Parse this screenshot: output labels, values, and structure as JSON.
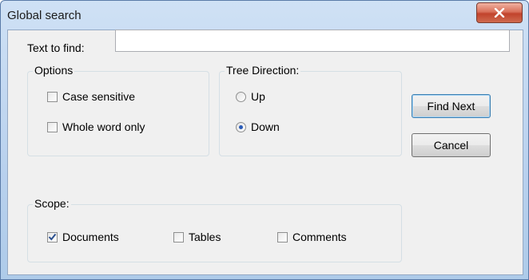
{
  "window": {
    "title": "Global search"
  },
  "search": {
    "label": "Text to find:",
    "value": "",
    "placeholder": ""
  },
  "options": {
    "title": "Options",
    "case_sensitive": {
      "label": "Case sensitive",
      "checked": false
    },
    "whole_word": {
      "label": "Whole word only",
      "checked": false
    }
  },
  "direction": {
    "title": "Tree Direction:",
    "up": {
      "label": "Up",
      "selected": false
    },
    "down": {
      "label": "Down",
      "selected": true
    }
  },
  "scope": {
    "title": "Scope:",
    "documents": {
      "label": "Documents",
      "checked": true
    },
    "tables": {
      "label": "Tables",
      "checked": false
    },
    "comments": {
      "label": "Comments",
      "checked": false
    }
  },
  "buttons": {
    "find_next": "Find Next",
    "cancel": "Cancel"
  },
  "icons": {
    "close": "close-icon",
    "check": "checkmark-icon"
  },
  "colors": {
    "close_button": "#c1432c",
    "radio_dot": "#2a5bb8",
    "check_mark": "#2a4f8f"
  }
}
